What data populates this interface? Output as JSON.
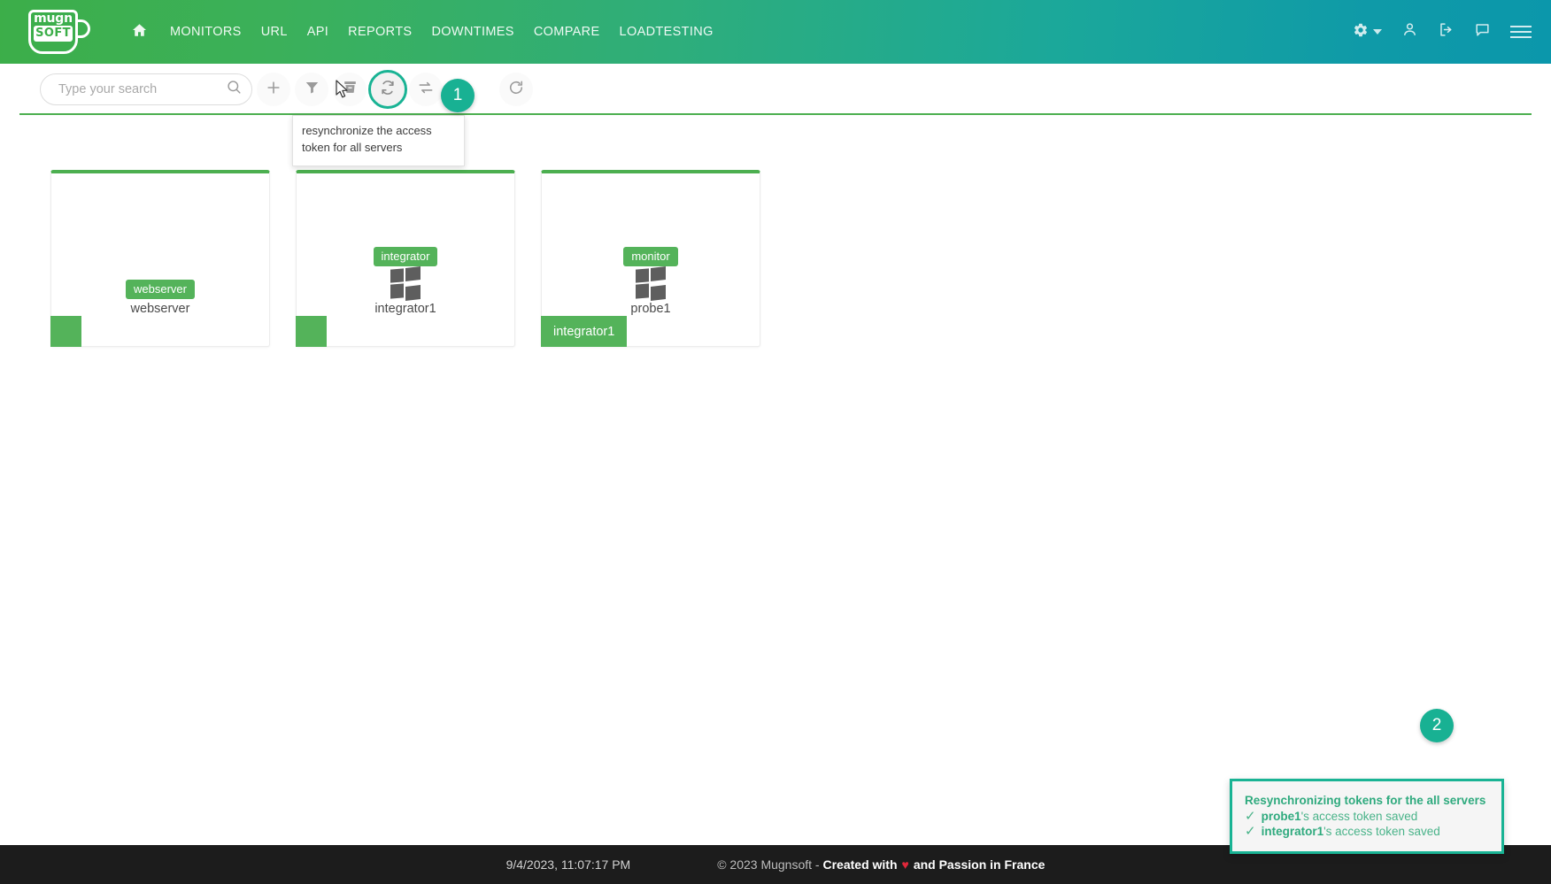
{
  "header": {
    "logo": {
      "top_text": "mugn",
      "bottom_text": "SOFT",
      "name": "mugnsoft-logo"
    },
    "nav": [
      {
        "label": "MONITORS",
        "name": "nav-monitors"
      },
      {
        "label": "URL",
        "name": "nav-url"
      },
      {
        "label": "API",
        "name": "nav-api"
      },
      {
        "label": "REPORTS",
        "name": "nav-reports"
      },
      {
        "label": "DOWNTIMES",
        "name": "nav-downtimes"
      },
      {
        "label": "COMPARE",
        "name": "nav-compare"
      },
      {
        "label": "LOADTESTING",
        "name": "nav-loadtesting"
      }
    ],
    "actions": [
      {
        "icon": "gear-icon",
        "label": "Settings"
      },
      {
        "icon": "user-icon",
        "label": "Account"
      },
      {
        "icon": "logout-icon",
        "label": "Logout"
      },
      {
        "icon": "chat-icon",
        "label": "Messages"
      },
      {
        "icon": "hamburger-menu-icon",
        "label": "Menu"
      }
    ],
    "colors": {
      "gradient_start": "#3cae49",
      "gradient_end": "#0b97ab"
    }
  },
  "toolbar": {
    "search": {
      "placeholder": "Type your search",
      "value": ""
    },
    "buttons": [
      {
        "name": "add-button",
        "icon": "plus-icon",
        "tooltip": "add"
      },
      {
        "name": "filter-button",
        "icon": "funnel-icon",
        "tooltip": "filter"
      },
      {
        "name": "archive-button",
        "icon": "archive-icon",
        "tooltip": "archive"
      },
      {
        "name": "resync-tokens-button",
        "icon": "resync-token-icon",
        "tooltip": "resynchronize the access token for all servers"
      },
      {
        "name": "sync-button",
        "icon": "sync-arrows-icon",
        "tooltip": "sync"
      },
      {
        "name": "refresh-button",
        "icon": "refresh-icon",
        "tooltip": "refresh"
      }
    ],
    "tooltip_text": "resynchronize the access token for all servers",
    "rule_color": "#4caf50"
  },
  "steps": [
    {
      "number": "1",
      "name": "step-badge-1"
    },
    {
      "number": "2",
      "name": "step-badge-2"
    }
  ],
  "cards": [
    {
      "tag": "webserver",
      "name": "webserver",
      "os_icon": null,
      "corner_label": null,
      "status_color": "#54b35a"
    },
    {
      "tag": "integrator",
      "name": "integrator1",
      "os_icon": "windows-icon",
      "corner_label": null,
      "status_color": "#54b35a"
    },
    {
      "tag": "monitor",
      "name": "probe1",
      "os_icon": "windows-icon",
      "corner_label": "integrator1",
      "status_color": "#54b35a"
    }
  ],
  "toast": {
    "title": "Resynchronizing tokens for the all servers",
    "lines": [
      {
        "server": "probe1",
        "message": "'s access token saved"
      },
      {
        "server": "integrator1",
        "message": "'s access token saved"
      }
    ],
    "accent_color": "#19b394"
  },
  "footer": {
    "timestamp": "9/4/2023, 11:07:17 PM",
    "copyright_prefix": "© 2023 Mugnsoft - ",
    "created_with": "Created with",
    "heart": "♥",
    "created_suffix": "and Passion in France"
  }
}
